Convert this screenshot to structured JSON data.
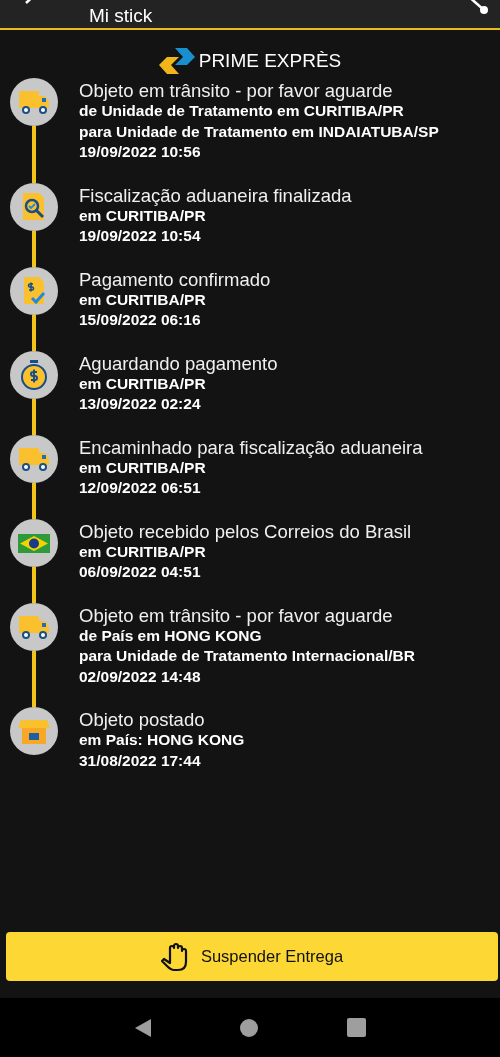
{
  "header": {
    "title": "Mi stick"
  },
  "carrier": {
    "name": "PRIME EXPRÈS"
  },
  "events": [
    {
      "kind": "truck",
      "title": "Objeto em trânsito - por favor aguarde",
      "lines": [
        "de Unidade de Tratamento em CURITIBA/PR",
        "para Unidade de Tratamento em INDAIATUBA/SP"
      ],
      "time": "19/09/2022 10:56"
    },
    {
      "kind": "inspect",
      "title": "Fiscalização aduaneira finalizada",
      "lines": [
        "em CURITIBA/PR"
      ],
      "time": "19/09/2022 10:54"
    },
    {
      "kind": "paid",
      "title": "Pagamento confirmado",
      "lines": [
        "em CURITIBA/PR"
      ],
      "time": "15/09/2022 06:16"
    },
    {
      "kind": "stopwatch",
      "title": "Aguardando pagamento",
      "lines": [
        "em CURITIBA/PR"
      ],
      "time": "13/09/2022 02:24"
    },
    {
      "kind": "truck",
      "title": "Encaminhado para fiscalização aduaneira",
      "lines": [
        "em CURITIBA/PR"
      ],
      "time": "12/09/2022 06:51"
    },
    {
      "kind": "flag",
      "title": "Objeto recebido pelos Correios do Brasil",
      "lines": [
        "em CURITIBA/PR"
      ],
      "time": "06/09/2022 04:51"
    },
    {
      "kind": "truck",
      "title": "Objeto em trânsito - por favor aguarde",
      "lines": [
        "de País em HONG KONG",
        "para Unidade de Tratamento Internacional/BR"
      ],
      "time": "02/09/2022 14:48"
    },
    {
      "kind": "store",
      "title": "Objeto postado",
      "lines": [
        "em País: HONG KONG"
      ],
      "time": "31/08/2022 17:44"
    }
  ],
  "action_button": {
    "label": "Suspender Entrega"
  }
}
